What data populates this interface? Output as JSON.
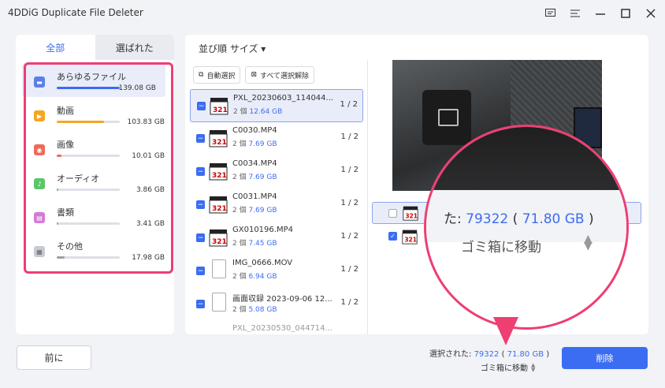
{
  "window": {
    "title": "4DDiG Duplicate File Deleter",
    "controls": [
      "feedback-icon",
      "menu-icon",
      "minimize-icon",
      "maximize-icon",
      "close-icon"
    ]
  },
  "tabs": [
    {
      "label": "全部"
    },
    {
      "label": "選ばれた"
    }
  ],
  "categories": [
    {
      "name": "あらゆるファイル",
      "size": "139.08 GB",
      "fill": 1.0,
      "color": "#3b6df2",
      "icon": "folder-icon"
    },
    {
      "name": "動画",
      "size": "103.83 GB",
      "fill": 0.75,
      "color": "#f5a623",
      "icon": "video-icon"
    },
    {
      "name": "画像",
      "size": "10.01 GB",
      "fill": 0.08,
      "color": "#ee6a5a",
      "icon": "image-icon"
    },
    {
      "name": "オーディオ",
      "size": "3.86 GB",
      "fill": 0.03,
      "color": "#5cc66a",
      "icon": "audio-icon"
    },
    {
      "name": "書類",
      "size": "3.41 GB",
      "fill": 0.03,
      "color": "#d57ad8",
      "icon": "document-icon"
    },
    {
      "name": "その他",
      "size": "17.98 GB",
      "fill": 0.13,
      "color": "#9a9ea8",
      "icon": "other-icon"
    }
  ],
  "sort": {
    "label": "並び順 サイズ ▾"
  },
  "actions": {
    "auto_select": "自動選択",
    "deselect_all": "すべて選択解除"
  },
  "files": [
    {
      "name": "PXL_20230603_114044...",
      "count": "2 個",
      "size": "12.64 GB",
      "pages": "1 / 2",
      "type": "video"
    },
    {
      "name": "C0030.MP4",
      "count": "2 個",
      "size": "7.69 GB",
      "pages": "1 / 2",
      "type": "video"
    },
    {
      "name": "C0034.MP4",
      "count": "2 個",
      "size": "7.69 GB",
      "pages": "1 / 2",
      "type": "video"
    },
    {
      "name": "C0031.MP4",
      "count": "2 個",
      "size": "7.69 GB",
      "pages": "1 / 2",
      "type": "video"
    },
    {
      "name": "GX010196.MP4",
      "count": "2 個",
      "size": "7.45 GB",
      "pages": "1 / 2",
      "type": "video"
    },
    {
      "name": "IMG_0666.MOV",
      "count": "2 個",
      "size": "6.94 GB",
      "pages": "1 / 2",
      "type": "doc"
    },
    {
      "name": "画面収録 2023-09-06 12...",
      "count": "2 個",
      "size": "5.08 GB",
      "pages": "1 / 2",
      "type": "doc"
    }
  ],
  "partial_file": "PXL_20230530_044714...",
  "magnifier": {
    "label": "た:",
    "count": "79322",
    "size": "71.80 GB",
    "trash": "ゴミ箱に移動"
  },
  "footer": {
    "back_label": "前に",
    "selected_label": "選択された:",
    "selected_count": "79322",
    "selected_size": "71.80 GB",
    "trash_label": "ゴミ箱に移動",
    "delete_label": "削除"
  }
}
